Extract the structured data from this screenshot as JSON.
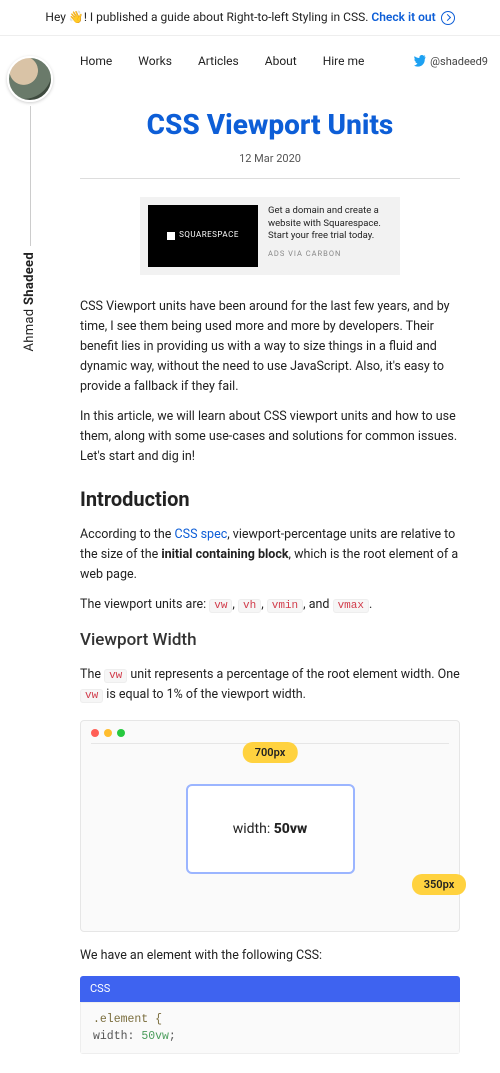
{
  "banner": {
    "pre": "Hey 👋! I published a guide about Right-to-left Styling in CSS. ",
    "link": "Check it out"
  },
  "author": {
    "first": "Ahmad",
    "last": "Shadeed"
  },
  "nav": {
    "items": [
      "Home",
      "Works",
      "Articles",
      "About",
      "Hire me"
    ],
    "twitter": "@shadeed9"
  },
  "article": {
    "title": "CSS Viewport Units",
    "date": "12 Mar 2020",
    "ad": {
      "brand": "SQUARESPACE",
      "copy": "Get a domain and create a website with Squarespace. Start your free trial today.",
      "via": "ADS VIA CARBON"
    },
    "p1": "CSS Viewport units have been around for the last few years, and by time, I see them being used more and more by developers. Their benefit lies in providing us with a way to size things in a fluid and dynamic way, without the need to use JavaScript. Also, it's easy to provide a fallback if they fail.",
    "p2": "In this article, we will learn about CSS viewport units and how to use them, along with some use-cases and solutions for common issues. Let's start and dig in!",
    "h2_intro": "Introduction",
    "intro_pre": "According to the ",
    "intro_link": "CSS spec",
    "intro_post": ", viewport-percentage units are relative to the size of the ",
    "intro_bold": "initial containing block",
    "intro_tail": ", which is the root element of a web page.",
    "units_pre": "The viewport units are: ",
    "units": {
      "u1": "vw",
      "u2": "vh",
      "u3": "vmin",
      "u4": "vmax"
    },
    "units_and": ", and ",
    "h3_vw": "Viewport Width",
    "vw_p_a": "The ",
    "vw_p_b": " unit represents a percentage of the root element width. One ",
    "vw_p_c": " is equal to 1% of the viewport width.",
    "fig": {
      "outer": "700px",
      "inner": "350px",
      "label_pre": "width: ",
      "label_bold": "50vw"
    },
    "p3": "We have an element with the following CSS:",
    "code": {
      "lang": "CSS",
      "selector": ".element {",
      "prop": "  width: ",
      "val": "50vw",
      "semi": ";"
    }
  }
}
